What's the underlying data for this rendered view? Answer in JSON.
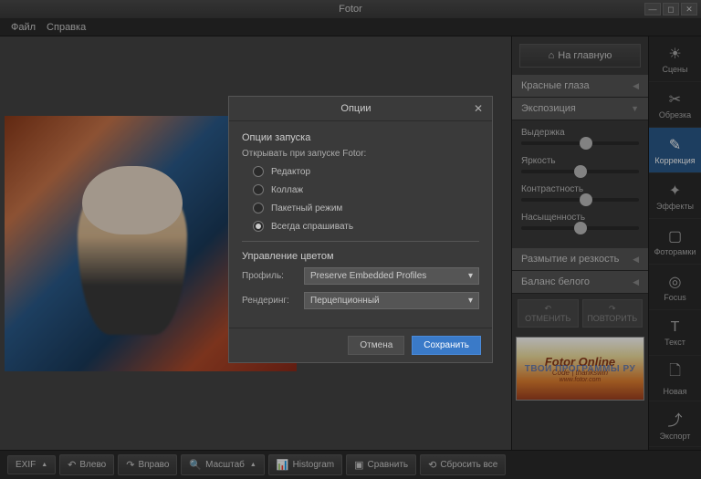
{
  "app": {
    "title": "Fotor"
  },
  "menubar": {
    "file": "Файл",
    "help": "Справка"
  },
  "header": {
    "home": "На главную"
  },
  "sidebar": {
    "accordions": {
      "red_eye": "Красные глаза",
      "exposure": "Экспозиция",
      "blur_sharp": "Размытие и резкость",
      "white_balance": "Баланс белого"
    },
    "exposure_sliders": {
      "exposure": "Выдержка",
      "brightness": "Яркость",
      "contrast": "Контрастность",
      "saturation": "Насыщенность"
    },
    "undo": "ОТМЕНИТЬ",
    "redo": "ПОВТОРИТЬ"
  },
  "promo": {
    "title": "Fotor Online",
    "code_line": "Code | thankswin",
    "url": "www.fotor.com",
    "watermark": "ТВОИ ПРОГРАММЫ РУ"
  },
  "tools": {
    "scenes": "Сцены",
    "crop": "Обрезка",
    "correction": "Коррекция",
    "effects": "Эффекты",
    "frames": "Фоторамки",
    "focus": "Focus",
    "text": "Текст",
    "new": "Новая",
    "export": "Экспорт"
  },
  "bottombar": {
    "exif": "EXIF",
    "left": "Влево",
    "right": "Вправо",
    "zoom": "Масштаб",
    "histogram": "Histogram",
    "compare": "Сравнить",
    "reset": "Сбросить все"
  },
  "modal": {
    "title": "Опции",
    "section_launch": "Опции запуска",
    "launch_subtitle": "Открывать при запуске Fotor:",
    "radios": {
      "editor": "Редактор",
      "collage": "Коллаж",
      "batch": "Пакетный режим",
      "ask": "Всегда спрашивать"
    },
    "section_color": "Управление цветом",
    "profile_label": "Профиль:",
    "profile_value": "Preserve Embedded Profiles",
    "rendering_label": "Рендеринг:",
    "rendering_value": "Перцепционный",
    "cancel": "Отмена",
    "save": "Сохранить"
  }
}
